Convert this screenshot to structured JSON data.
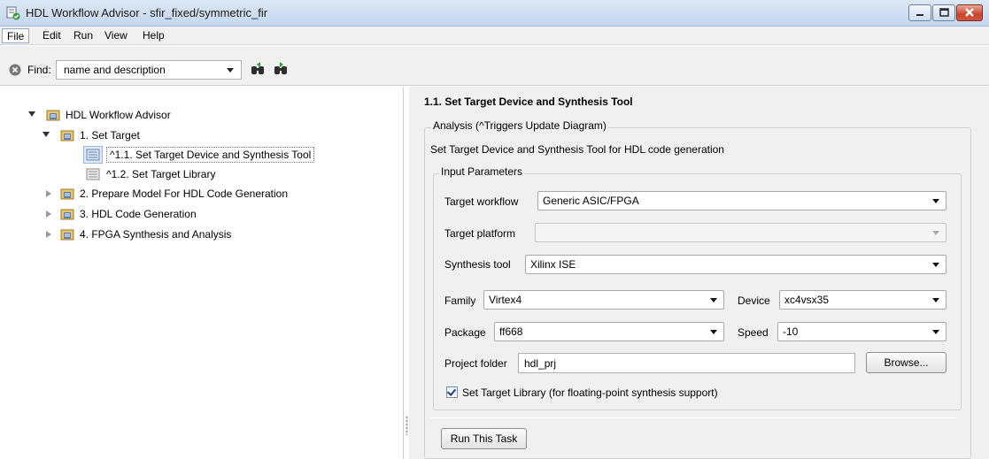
{
  "window": {
    "title": "HDL Workflow Advisor - sfir_fixed/symmetric_fir"
  },
  "menu": {
    "file": "File",
    "edit": "Edit",
    "run": "Run",
    "view": "View",
    "help": "Help"
  },
  "find": {
    "label": "Find:",
    "scope": "name and description"
  },
  "tree": {
    "root": "HDL Workflow Advisor",
    "set_target": "1. Set Target",
    "task_1_1": "^1.1. Set Target Device and Synthesis Tool",
    "task_1_2": "^1.2. Set Target Library",
    "prepare": "2. Prepare Model For HDL Code Generation",
    "codegen": "3. HDL Code Generation",
    "fpga": "4. FPGA Synthesis and Analysis"
  },
  "task": {
    "title": "1.1. Set Target Device and Synthesis Tool",
    "analysis_legend": "Analysis (^Triggers Update Diagram)",
    "description": "Set Target Device and Synthesis Tool for HDL code generation",
    "params_legend": "Input Parameters",
    "target_workflow_label": "Target workflow",
    "target_workflow_value": "Generic ASIC/FPGA",
    "target_platform_label": "Target platform",
    "target_platform_value": "",
    "synthesis_tool_label": "Synthesis tool",
    "synthesis_tool_value": "Xilinx ISE",
    "family_label": "Family",
    "family_value": "Virtex4",
    "device_label": "Device",
    "device_value": "xc4vsx35",
    "package_label": "Package",
    "package_value": "ff668",
    "speed_label": "Speed",
    "speed_value": "-10",
    "project_folder_label": "Project folder",
    "project_folder_value": "hdl_prj",
    "browse_label": "Browse...",
    "target_library_checkbox": "Set Target Library (for floating-point synthesis support)",
    "target_library_checked": true,
    "run_label": "Run This Task"
  }
}
